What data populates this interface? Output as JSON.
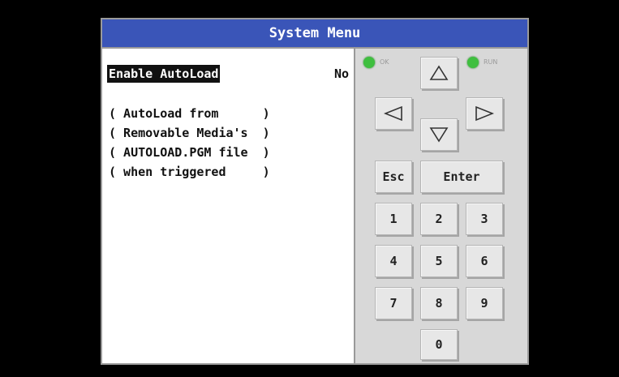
{
  "title": "System Menu",
  "setting": {
    "label": "Enable AutoLoad",
    "value": "No"
  },
  "description_lines": [
    "( AutoLoad from      )",
    "( Removable Media's  )",
    "( AUTOLOAD.PGM file  )",
    "( when triggered     )"
  ],
  "indicators": {
    "ok_label": "OK",
    "run_label": "RUN",
    "led_color": "#3fbf3f"
  },
  "keys": {
    "up": "up-arrow",
    "down": "down-arrow",
    "left": "left-arrow",
    "right": "right-arrow",
    "esc": "Esc",
    "enter": "Enter",
    "digits": [
      "1",
      "2",
      "3",
      "4",
      "5",
      "6",
      "7",
      "8",
      "9",
      "0"
    ]
  },
  "colors": {
    "title_bar": "#3a55b8",
    "background": "#000000"
  }
}
